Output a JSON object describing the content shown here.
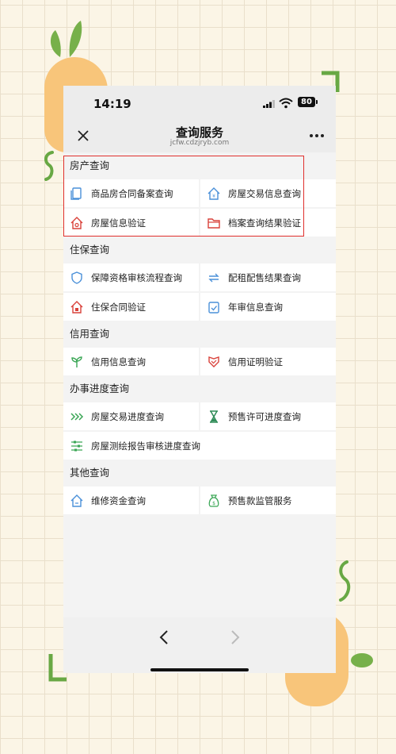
{
  "status_bar": {
    "time": "14:19",
    "battery": "80"
  },
  "nav": {
    "title": "查询服务",
    "url": "jcfw.cdzjryb.com"
  },
  "sections": [
    {
      "title": "房产查询",
      "items": [
        {
          "label": "商品房合同备案查询",
          "icon": "contract-icon"
        },
        {
          "label": "房屋交易信息查询",
          "icon": "house-yen-icon"
        },
        {
          "label": "房屋信息验证",
          "icon": "house-check-icon"
        },
        {
          "label": "档案查询结果验证",
          "icon": "folder-icon"
        }
      ]
    },
    {
      "title": "住保查询",
      "items": [
        {
          "label": "保障资格审核流程查询",
          "icon": "shield-icon"
        },
        {
          "label": "配租配售结果查询",
          "icon": "exchange-icon"
        },
        {
          "label": "住保合同验证",
          "icon": "house-doc-icon"
        },
        {
          "label": "年审信息查询",
          "icon": "clipboard-check-icon"
        }
      ]
    },
    {
      "title": "信用查询",
      "items": [
        {
          "label": "信用信息查询",
          "icon": "sprout-icon"
        },
        {
          "label": "信用证明验证",
          "icon": "badge-icon"
        }
      ]
    },
    {
      "title": "办事进度查询",
      "items": [
        {
          "label": "房屋交易进度查询",
          "icon": "chevrons-right-icon"
        },
        {
          "label": "预售许可进度查询",
          "icon": "hourglass-icon"
        },
        {
          "label": "房屋测绘报告审核进度查询",
          "icon": "sliders-icon"
        }
      ]
    },
    {
      "title": "其他查询",
      "items": [
        {
          "label": "维修资金查询",
          "icon": "house-money-icon"
        },
        {
          "label": "预售款监管服务",
          "icon": "money-bag-icon"
        }
      ]
    }
  ],
  "colors": {
    "accent_blue": "#4a90d9",
    "accent_red": "#d9413a",
    "accent_green": "#3aa655",
    "highlight": "#e0302d"
  }
}
